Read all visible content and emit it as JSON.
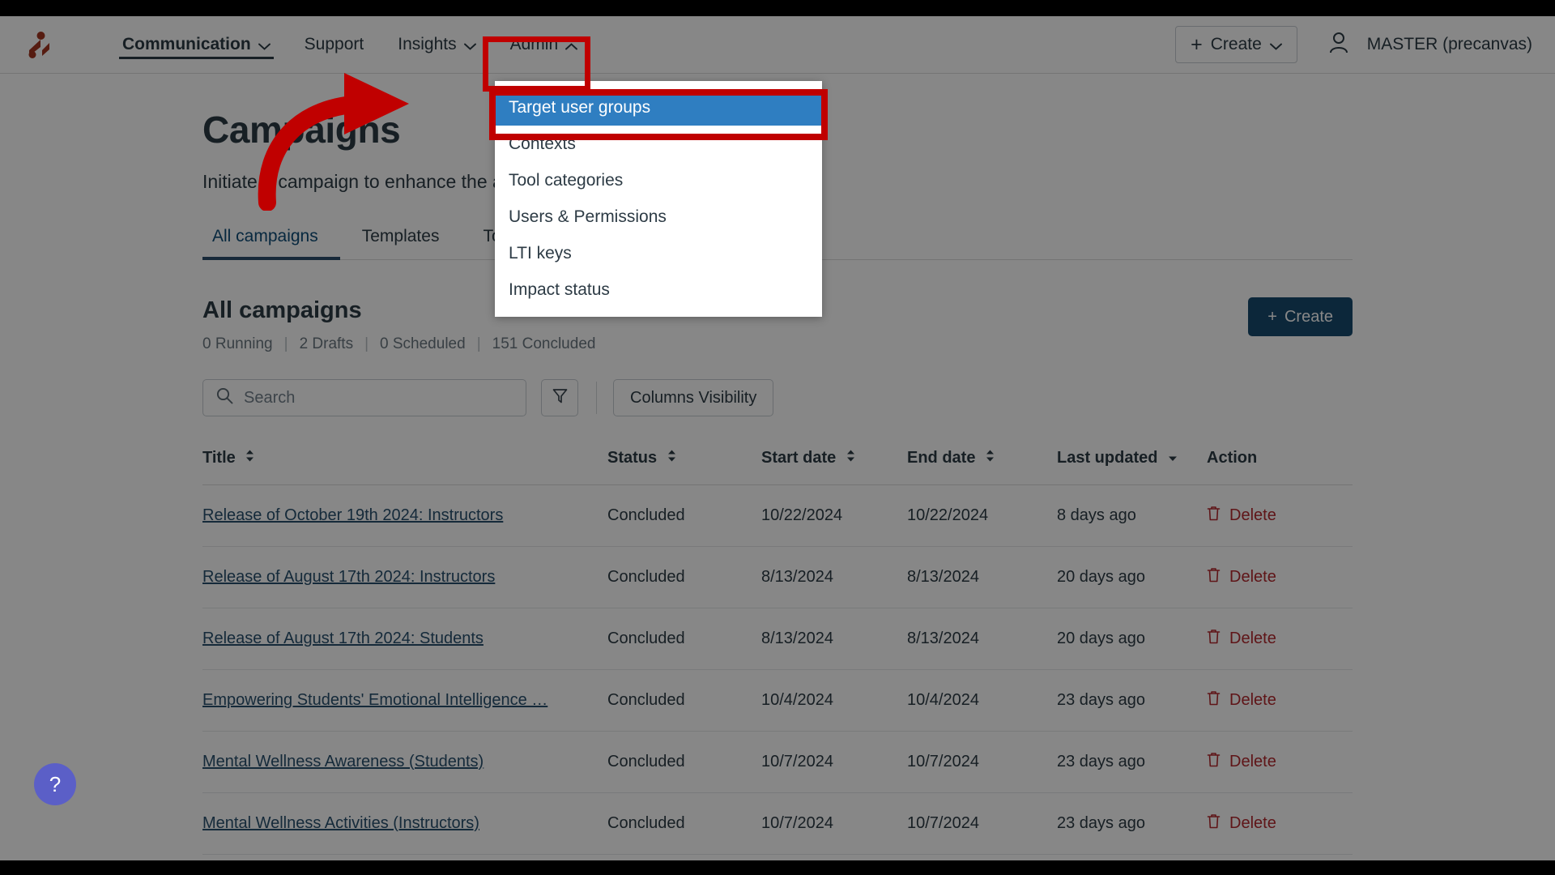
{
  "topnav": {
    "logo_name": "app-logo",
    "items": [
      {
        "label": "Communication",
        "has_caret": true,
        "active": true
      },
      {
        "label": "Support",
        "has_caret": false,
        "active": false
      },
      {
        "label": "Insights",
        "has_caret": true,
        "active": false
      },
      {
        "label": "Admin",
        "has_caret": true,
        "active": false,
        "open": true
      }
    ],
    "create_label": "Create",
    "user_label": "MASTER (precanvas)"
  },
  "dropdown": {
    "items": [
      {
        "label": "Target user groups",
        "selected": true
      },
      {
        "label": "Contexts",
        "selected": false
      },
      {
        "label": "Tool categories",
        "selected": false
      },
      {
        "label": "Users & Permissions",
        "selected": false
      },
      {
        "label": "LTI keys",
        "selected": false
      },
      {
        "label": "Impact status",
        "selected": false
      }
    ]
  },
  "page": {
    "title": "Campaigns",
    "subtitle": "Initiate a campaign to enhance the adoption of features and tools",
    "tabs": [
      {
        "label": "All campaigns",
        "active": true
      },
      {
        "label": "Templates",
        "active": false
      },
      {
        "label": "Tools",
        "active": false
      }
    ]
  },
  "section": {
    "title": "All campaigns",
    "counts": [
      {
        "value": "0 Running"
      },
      {
        "value": "2 Drafts"
      },
      {
        "value": "0 Scheduled"
      },
      {
        "value": "151 Concluded"
      }
    ],
    "create_label": "Create"
  },
  "toolbar": {
    "search_placeholder": "Search",
    "search_value": "",
    "filter_icon": "funnel-icon",
    "columns_label": "Columns Visibility"
  },
  "table": {
    "headers": [
      {
        "label": "Title",
        "sortable": true,
        "sort": "none"
      },
      {
        "label": "Status",
        "sortable": true,
        "sort": "none"
      },
      {
        "label": "Start date",
        "sortable": true,
        "sort": "none"
      },
      {
        "label": "End date",
        "sortable": true,
        "sort": "none"
      },
      {
        "label": "Last updated",
        "sortable": true,
        "sort": "desc"
      },
      {
        "label": "Action",
        "sortable": false,
        "sort": "none"
      }
    ],
    "delete_label": "Delete",
    "rows": [
      {
        "title": "Release of October 19th 2024: Instructors",
        "status": "Concluded",
        "start": "10/22/2024",
        "end": "10/22/2024",
        "updated": "8 days ago"
      },
      {
        "title": "Release of August 17th 2024: Instructors",
        "status": "Concluded",
        "start": "8/13/2024",
        "end": "8/13/2024",
        "updated": "20 days ago"
      },
      {
        "title": "Release of August 17th 2024: Students",
        "status": "Concluded",
        "start": "8/13/2024",
        "end": "8/13/2024",
        "updated": "20 days ago"
      },
      {
        "title": "Empowering Students' Emotional Intelligence …",
        "status": "Concluded",
        "start": "10/4/2024",
        "end": "10/4/2024",
        "updated": "23 days ago"
      },
      {
        "title": "Mental Wellness Awareness (Students)",
        "status": "Concluded",
        "start": "10/7/2024",
        "end": "10/7/2024",
        "updated": "23 days ago"
      },
      {
        "title": "Mental Wellness Activities (Instructors)",
        "status": "Concluded",
        "start": "10/7/2024",
        "end": "10/7/2024",
        "updated": "23 days ago"
      }
    ]
  },
  "help": {
    "label": "?"
  },
  "colors": {
    "annotation": "#c00000",
    "menu_selected": "#2f7ec1",
    "primary": "#174a6e",
    "link": "#28506e",
    "delete": "#b3292e",
    "logo": "#a33620"
  }
}
